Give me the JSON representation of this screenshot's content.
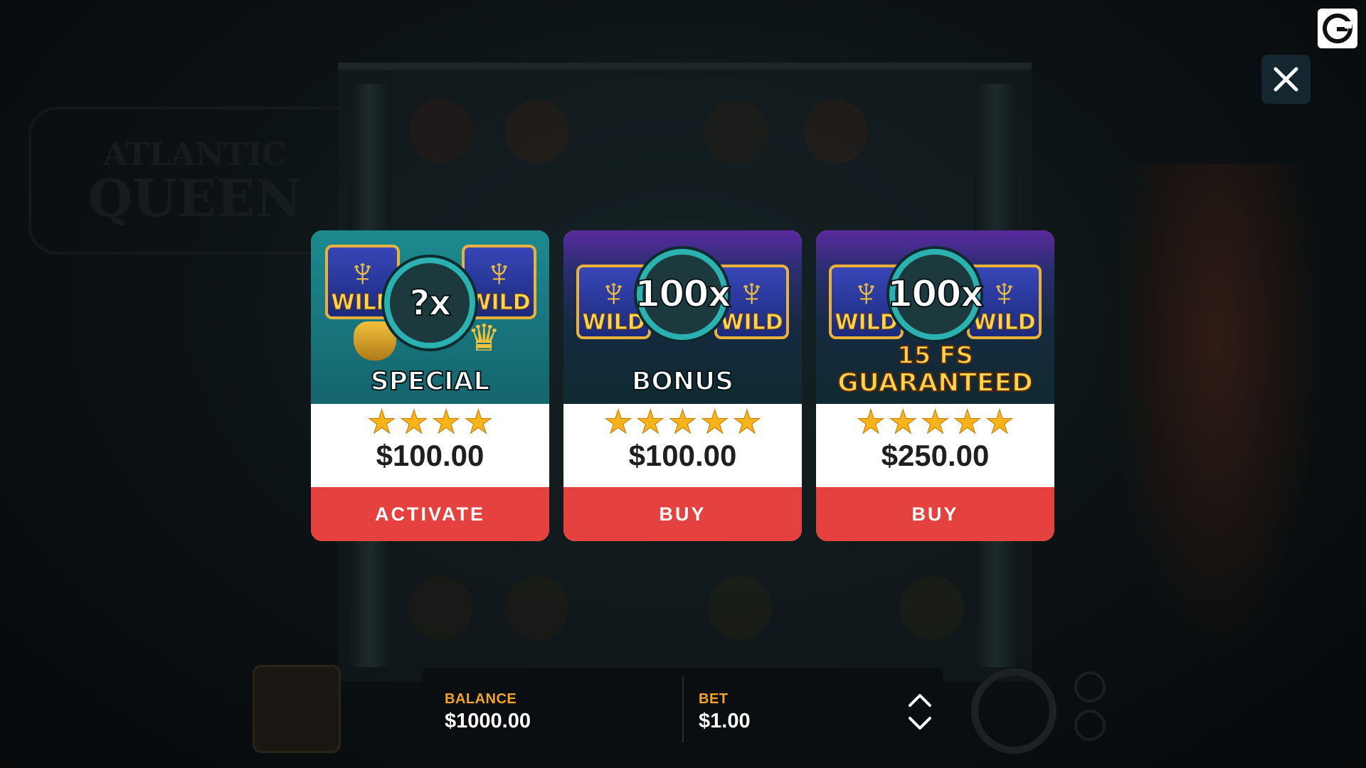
{
  "offers": [
    {
      "badge": "?x",
      "wild_label": "WILD",
      "title": "SPECIAL",
      "subtitle": "",
      "stars": "★★★★",
      "price": "$100.00",
      "action": "ACTIVATE"
    },
    {
      "badge": "100x",
      "wild_label": "WILD",
      "title": "BONUS",
      "subtitle": "",
      "stars": "★★★★★",
      "price": "$100.00",
      "action": "BUY"
    },
    {
      "badge": "100x",
      "wild_label": "WILD",
      "title": "GUARANTEED",
      "subtitle": "15 FS",
      "stars": "★★★★★",
      "price": "$250.00",
      "action": "BUY"
    }
  ],
  "hud": {
    "balance_label": "BALANCE",
    "balance_value": "$1000.00",
    "bet_label": "BET",
    "bet_value": "$1.00"
  },
  "background": {
    "logo_line1": "ATLANTIC",
    "logo_line2": "QUEEN"
  },
  "icons": {
    "close": "close-icon",
    "brand": "brand-g-icon",
    "bet_up": "chevron-up-icon",
    "bet_down": "chevron-down-icon"
  },
  "colors": {
    "cta": "#e4413f",
    "hud_label": "#f2a42a",
    "star": "#f7b318",
    "badge_ring": "#2bb2b0"
  }
}
